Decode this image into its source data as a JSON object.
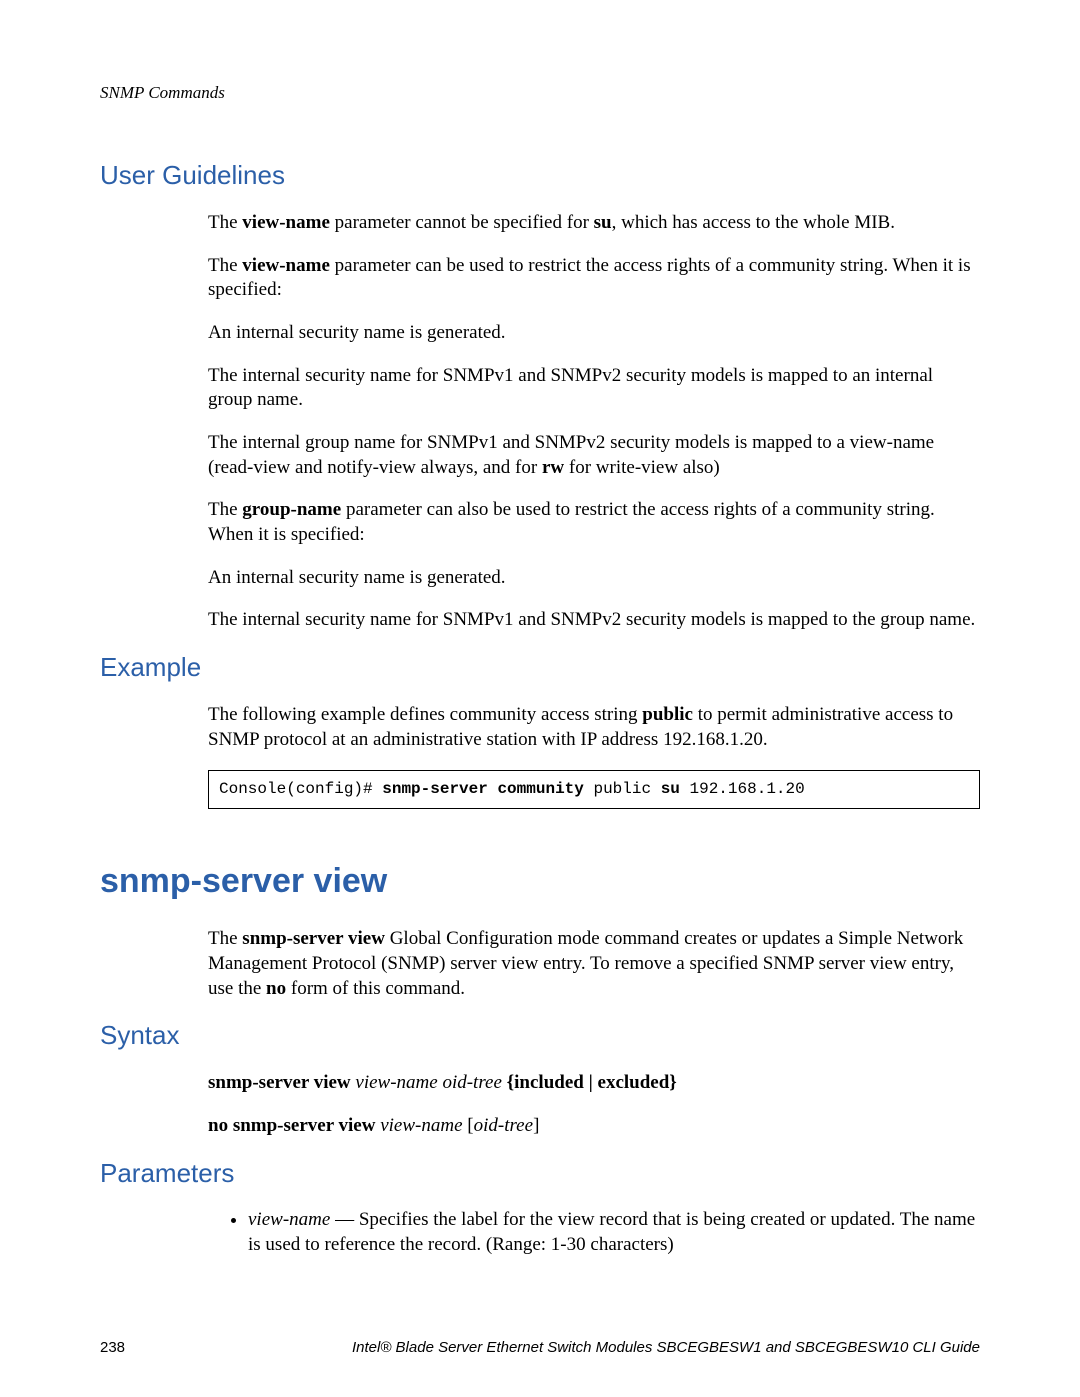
{
  "header": {
    "running": "SNMP Commands"
  },
  "sections": {
    "user_guidelines": {
      "title": "User Guidelines",
      "p1_a": "The ",
      "p1_b": "view-name",
      "p1_c": " parameter cannot be specified for ",
      "p1_d": "su",
      "p1_e": ", which has access to the whole MIB.",
      "p2_a": "The ",
      "p2_b": "view-name",
      "p2_c": " parameter can be used to restrict the access rights of a community string. When it is specified:",
      "p3": "An internal security name is generated.",
      "p4": "The internal security name for SNMPv1 and SNMPv2 security models is mapped to an internal group name.",
      "p5_a": "The internal group name for SNMPv1 and SNMPv2 security models is mapped to a view-name (read-view and notify-view always, and for ",
      "p5_b": "rw",
      "p5_c": " for write-view also)",
      "p6_a": "The ",
      "p6_b": "group-name",
      "p6_c": " parameter can also be used to restrict the access rights of a community string. When it is specified:",
      "p7": "An internal security name is generated.",
      "p8": "The internal security name for SNMPv1 and SNMPv2 security models is mapped to the group name."
    },
    "example": {
      "title": "Example",
      "p1_a": "The following example defines community access string ",
      "p1_b": "public",
      "p1_c": " to permit administrative access to SNMP protocol at an administrative station with IP address 192.168.1.20.",
      "code_prompt": "Console(config)# ",
      "code_bold": "snmp-server community ",
      "code_mid": "public ",
      "code_bold2": "su ",
      "code_tail": "192.168.1.20"
    },
    "command": {
      "title": "snmp-server view",
      "p1_a": "The ",
      "p1_b": "snmp-server view",
      "p1_c": " Global Configuration mode command creates or updates a Simple Network Management Protocol (SNMP) server view entry. To remove a specified SNMP server view entry, use the ",
      "p1_d": "no",
      "p1_e": " form of this command."
    },
    "syntax": {
      "title": "Syntax",
      "line1_a": "snmp-server view ",
      "line1_b": "view-name oid-tree ",
      "line1_c": "{included | excluded}",
      "line2_a": "no snmp-server view ",
      "line2_b": "view-name ",
      "line2_c": "[",
      "line2_d": "oid-tree",
      "line2_e": "]"
    },
    "parameters": {
      "title": "Parameters",
      "item1_a": "view-name",
      "item1_b": " — Specifies the label for the view record that is being created or updated. The name is used to reference the record. (Range: 1-30 characters)"
    }
  },
  "footer": {
    "page": "238",
    "title": "Intel® Blade Server Ethernet Switch Modules SBCEGBESW1 and SBCEGBESW10 CLI Guide"
  }
}
